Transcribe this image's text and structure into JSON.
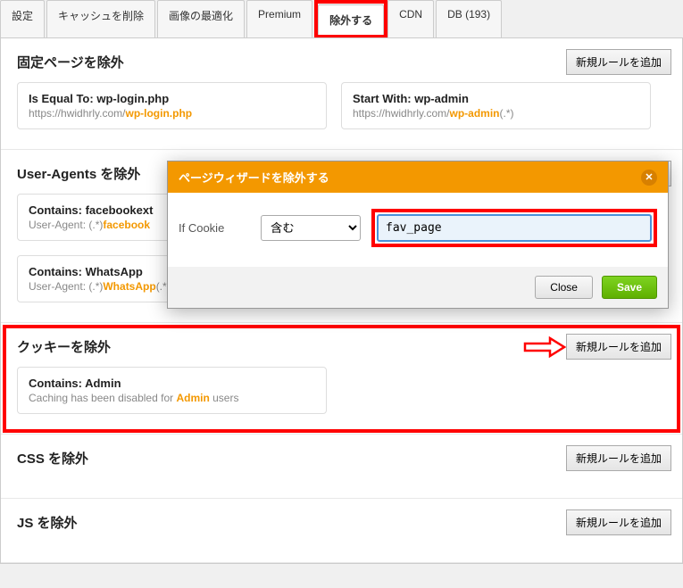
{
  "tabs": {
    "items": [
      {
        "label": "設定"
      },
      {
        "label": "キャッシュを削除"
      },
      {
        "label": "画像の最適化"
      },
      {
        "label": "Premium"
      },
      {
        "label": "除外する"
      },
      {
        "label": "CDN"
      },
      {
        "label": "DB (193)"
      }
    ],
    "active_index": 4
  },
  "buttons": {
    "add_rule": "新規ルールを追加"
  },
  "sections": {
    "pages": {
      "title": "固定ページを除外",
      "cards": [
        {
          "title_prefix": "Is Equal To: ",
          "title_value": "wp-login.php",
          "sub_prefix": "https://hwidhrly.com/",
          "sub_value": "wp-login.php",
          "sub_suffix": ""
        },
        {
          "title_prefix": "Start With: ",
          "title_value": "wp-admin",
          "sub_prefix": "https://hwidhrly.com/",
          "sub_value": "wp-admin",
          "sub_suffix": "(.*)"
        }
      ]
    },
    "ua": {
      "title": "User-Agents を除外",
      "cards": [
        {
          "title_prefix": "Contains: ",
          "title_value": "facebookext",
          "sub_prefix": "User-Agent: (.*)",
          "sub_value": "facebook",
          "sub_suffix": ""
        },
        {
          "title_prefix": "Contains: ",
          "title_value": "WhatsApp",
          "sub_prefix": "User-Agent: (.*)",
          "sub_value": "WhatsApp",
          "sub_suffix": "(.*)"
        }
      ]
    },
    "cookies": {
      "title": "クッキーを除外",
      "card": {
        "title_prefix": "Contains: ",
        "title_value": "Admin",
        "sub_prefix": "Caching has been disabled for ",
        "sub_value": "Admin",
        "sub_suffix": " users"
      }
    },
    "css": {
      "title": "CSS を除外"
    },
    "js": {
      "title": "JS を除外"
    }
  },
  "modal": {
    "title": "ページウィザードを除外する",
    "label": "If Cookie",
    "select_value": "含む",
    "input_value": "fav_page",
    "close": "Close",
    "save": "Save"
  }
}
